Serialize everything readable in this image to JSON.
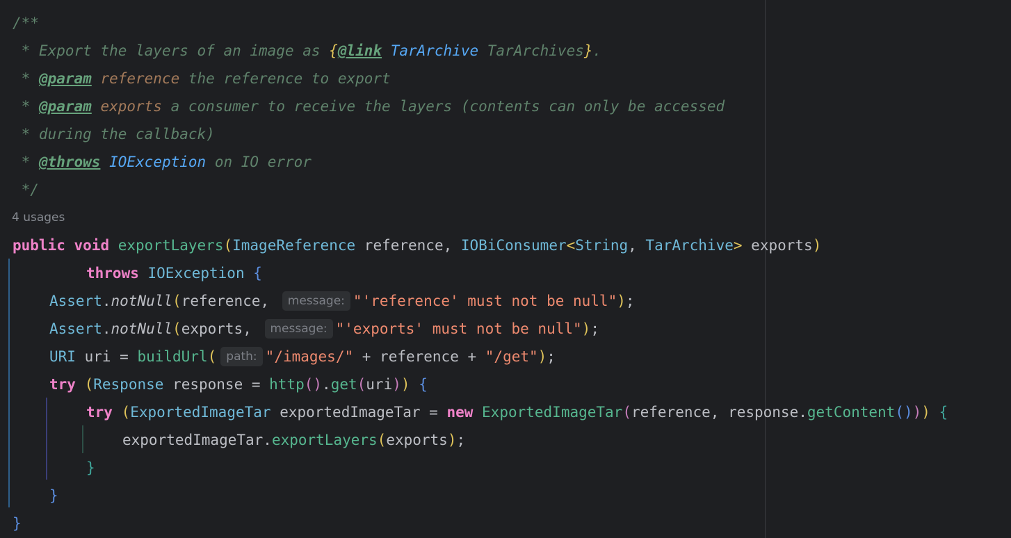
{
  "editor": {
    "doc_comment": {
      "open": "/**",
      "line1_star": " * ",
      "line1_text": "Export the layers of an image as ",
      "line1_brace_open": "{",
      "line1_link_tag": "@link",
      "line1_link_class": "TarArchive",
      "line1_link_label": " TarArchives",
      "line1_brace_close": "}",
      "line1_end": ".",
      "param1_tag": "@param",
      "param1_name": "reference",
      "param1_text": " the reference to export",
      "param2_tag": "@param",
      "param2_name": "exports",
      "param2_text": " a consumer to receive the layers (contents can only be accessed",
      "line5_text": " * during the callback)",
      "throws_tag": "@throws",
      "throws_class": "IOException",
      "throws_text": " on IO error",
      "close": " */",
      "star": " * "
    },
    "usages": "4 usages",
    "code": {
      "kw_public": "public",
      "kw_void": "void",
      "method_name": "exportLayers",
      "param_type1": "ImageReference",
      "param_name1": "reference",
      "param_type2": "IOBiConsumer",
      "generic_open": "<",
      "generic_t1": "String",
      "generic_t2": "TarArchive",
      "generic_close": ">",
      "param_name2": "exports",
      "kw_throws": "throws",
      "throws_type": "IOException",
      "assert_cls": "Assert",
      "assert_method": "notNull",
      "assert1_arg": "reference",
      "assert1_hint": "message:",
      "assert1_str": "\"'reference' must not be null\"",
      "assert2_arg": "exports",
      "assert2_hint": "message:",
      "assert2_str": "\"'exports' must not be null\"",
      "uri_type": "URI",
      "uri_var": "uri",
      "build_fn": "buildUrl",
      "path_hint": "path:",
      "str_images": "\"/images/\"",
      "ref_var": "reference",
      "str_get": "\"/get\"",
      "kw_try": "try",
      "response_type": "Response",
      "response_var": "response",
      "http_fn": "http",
      "get_fn": "get",
      "uri_arg": "uri",
      "tar_type": "ExportedImageTar",
      "tar_var": "exportedImageTar",
      "kw_new": "new",
      "tar_ctor": "ExportedImageTar",
      "ctor_arg1": "reference",
      "ctor_arg2_obj": "response",
      "ctor_arg2_method": "getContent",
      "call_obj": "exportedImageTar",
      "call_method": "exportLayers",
      "call_arg": "exports"
    }
  },
  "colors": {
    "background": "#1e1f22",
    "doc_comment": "#5f826b",
    "keyword": "#cf8e6d",
    "string": "#ee8a6f",
    "type": "#6fb9d8",
    "method": "#56a8f5"
  }
}
